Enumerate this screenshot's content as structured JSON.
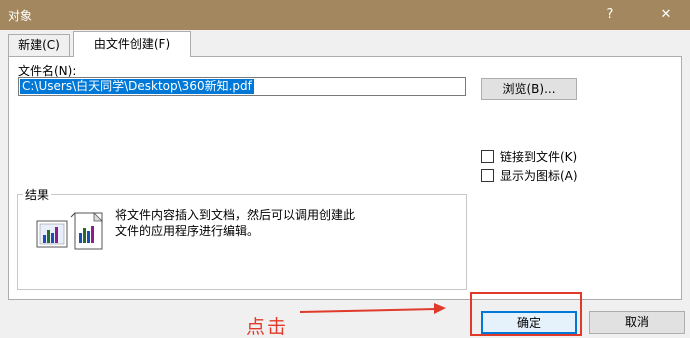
{
  "window": {
    "title": "对象",
    "help": "?",
    "close": "✕"
  },
  "tabs": [
    {
      "label": "新建(C)"
    },
    {
      "label": "由文件创建(F)"
    }
  ],
  "file": {
    "label": "文件名(N):",
    "value": "C:\\Users\\白天同学\\Desktop\\360新知.pdf"
  },
  "buttons": {
    "browse": "浏览(B)...",
    "ok": "确定",
    "cancel": "取消"
  },
  "checkboxes": [
    {
      "label": "链接到文件(K)",
      "checked": false
    },
    {
      "label": "显示为图标(A)",
      "checked": false
    }
  ],
  "result": {
    "title": "结果",
    "line1": "将文件内容插入到文档，然后可以调用创建此",
    "line2": "文件的应用程序进行编辑。"
  },
  "annotation": {
    "text": "点击",
    "color": "#e03a2a"
  }
}
